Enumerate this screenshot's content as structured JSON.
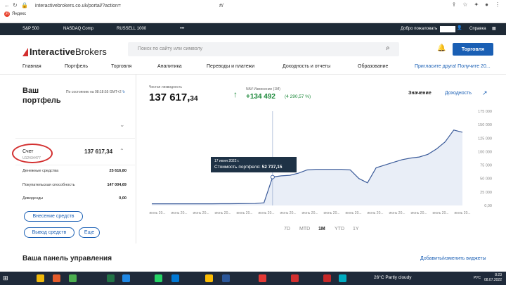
{
  "browser": {
    "url": "interactivebrokers.co.uk/portal/?action=",
    "url_tail": "#/",
    "bookmark": "Яндекс"
  },
  "ticker": {
    "items": [
      "S&P 500",
      "NASDAQ Comp",
      "RUSSELL 1000",
      "•••"
    ],
    "welcome": "Добро пожаловать",
    "help": "Справка"
  },
  "header": {
    "logo_bold": "Interactive",
    "logo_rest": "Brokers",
    "search_placeholder": "Поиск по сайту или символу",
    "trade_label": "Торговля"
  },
  "nav": {
    "items": [
      "Главная",
      "Портфель",
      "Торговля",
      "Аналитика",
      "Переводы и платежи",
      "Доходность и отчеты",
      "Образование"
    ],
    "promo": "Пригласите друга! Получите 20..."
  },
  "portfolio": {
    "title": "Ваш портфель",
    "as_of": "По состоянию на 08:18:55 GMT+2",
    "account_label": "Счет",
    "account_number": "U12434477",
    "account_value": "137 617,34",
    "rows": [
      {
        "label": "Денежные средства",
        "value": "25 616,80"
      },
      {
        "label": "Покупательская способность",
        "value": "147 004,69"
      },
      {
        "label": "Дивиденды",
        "value": "0,00"
      }
    ],
    "buttons": {
      "deposit": "Внесение средств",
      "withdraw": "Вывод средств",
      "more": "Еще"
    }
  },
  "summary": {
    "nav_label": "Чистая ликвидность",
    "nav_value_int": "137 617,",
    "nav_value_dec": "34",
    "change_label": "NAV Изменение (1М)",
    "change_value": "+134 492",
    "change_pct": "(4 290,57 %)",
    "toggle_value": "Значение",
    "toggle_return": "Доходность"
  },
  "tooltip": {
    "date": "17 июня 2022 г.",
    "label": "Стоимость портфеля:",
    "value": "52 737,15"
  },
  "ranges": [
    "7D",
    "MTD",
    "1M",
    "YTD",
    "1Y"
  ],
  "active_range": "1M",
  "dashboard": {
    "title": "Ваша панель управления",
    "link": "Добавить/изменить виджеты"
  },
  "taskbar": {
    "weather": "26°C  Partly cloudy",
    "lang": "РУС",
    "time": "8:23",
    "date": "08.07.2022"
  },
  "colors": {
    "brand_blue": "#1a5fb4",
    "positive": "#1e8a3c",
    "line": "#3b5b9a",
    "ticker_bg": "#1e2a36",
    "annotation": "#d32f2f"
  },
  "chart_data": {
    "type": "area",
    "y_ticks": [
      "175 000",
      "150 000",
      "125 000",
      "100 000",
      "75 000",
      "50 000",
      "25 000",
      "0,00"
    ],
    "ylim": [
      0,
      175000
    ],
    "x_ticks": [
      "июнь 20...",
      "июнь 20...",
      "июнь 20...",
      "июнь 20...",
      "июнь 20...",
      "июнь 20...",
      "июнь 20...",
      "июнь 20...",
      "июнь 20...",
      "июнь 20...",
      "июнь 20...",
      "июнь 20...",
      "июнь 20...",
      "июль 20...",
      "июль 20..."
    ],
    "x": [
      0,
      1,
      2,
      3,
      4,
      5,
      6,
      7,
      8,
      9,
      10,
      11,
      12,
      13,
      14,
      15,
      16,
      17,
      18,
      19,
      20,
      21,
      22,
      23,
      24,
      25,
      26,
      27,
      28
    ],
    "values": [
      3100,
      3100,
      3100,
      3100,
      3100,
      3100,
      3100,
      3100,
      3200,
      3300,
      3400,
      3500,
      3600,
      5000,
      52737,
      55000,
      56000,
      60000,
      66000,
      67000,
      67000,
      67000,
      67000,
      66000,
      50000,
      42000,
      70000,
      75000,
      80000,
      85000,
      88000,
      90000,
      95000,
      105000,
      118000,
      140000,
      136000
    ],
    "grid": false
  }
}
